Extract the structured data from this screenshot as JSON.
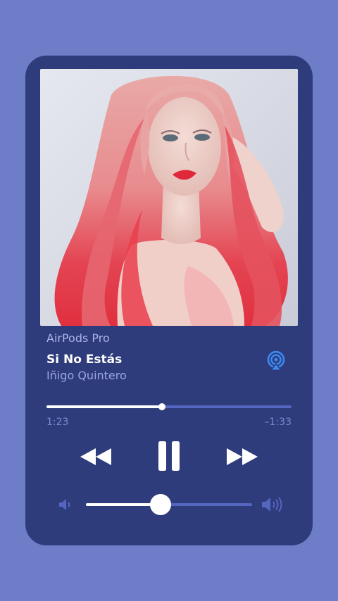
{
  "player": {
    "device": "AirPods Pro",
    "track_title": "Si No Estás",
    "artist": "Iñigo Quintero",
    "elapsed": "1:23",
    "remaining": "–1:33",
    "progress_fraction": 0.47,
    "volume_fraction": 0.45
  },
  "icons": {
    "airplay": "airplay-audio-icon",
    "previous": "rewind-icon",
    "play_pause": "pause-icon",
    "next": "fast-forward-icon",
    "volume_low": "speaker-low-icon",
    "volume_high": "speaker-high-icon"
  },
  "colors": {
    "background": "#6d7dc7",
    "card": "#2f3c7c",
    "accent": "#3b8bf5",
    "track": "#5566c0",
    "text_primary": "#ffffff",
    "text_secondary": "#9aa6de"
  }
}
